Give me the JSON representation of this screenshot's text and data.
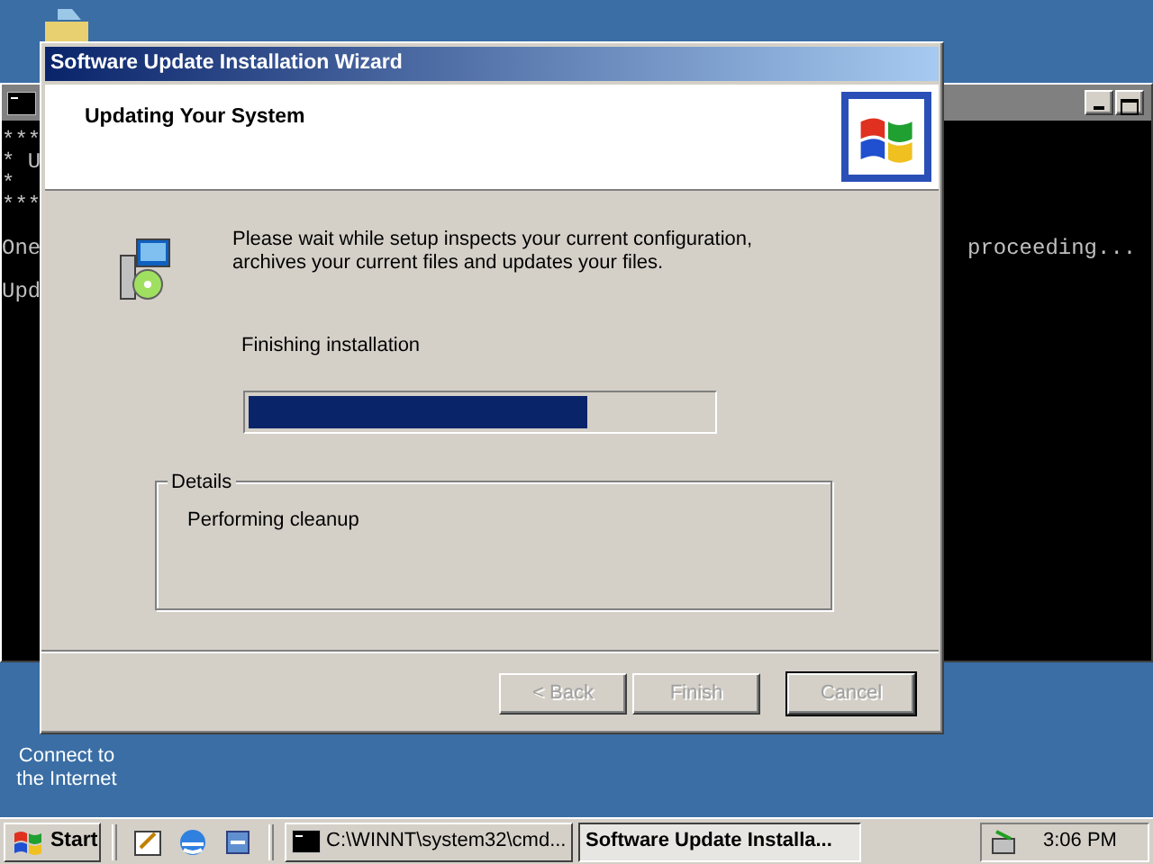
{
  "desktop_icons": [
    {
      "label": "Connect to the Internet"
    }
  ],
  "console": {
    "blocks": [
      {
        "lines": [
          "***",
          "* U",
          "*",
          "***"
        ]
      },
      {
        "lines": [
          "One"
        ],
        "tail": "proceeding..."
      },
      {
        "lines": [
          "Upd"
        ]
      }
    ]
  },
  "wizard": {
    "title": "Software Update Installation Wizard",
    "heading": "Updating Your System",
    "intro": "Please wait while setup inspects your current configuration, archives your current files and updates your files.",
    "status": "Finishing installation",
    "progress": {
      "level": 0.73
    },
    "details": {
      "legend": "Details",
      "text": "Performing cleanup"
    },
    "buttons": [
      {
        "label": "< Back",
        "disabled": true,
        "default": false
      },
      {
        "label": "Finish",
        "disabled": true,
        "default": false
      },
      {
        "label": "Cancel",
        "disabled": true,
        "default": true
      }
    ]
  },
  "taskbar": {
    "start": "Start",
    "quick_launch": [
      {
        "kind": "desktop"
      },
      {
        "kind": "browser"
      },
      {
        "kind": "channels"
      }
    ],
    "tasks": [
      {
        "label": "C:\\WINNT\\system32\\cmd...",
        "selected": false
      },
      {
        "label": "Software Update Installa...",
        "selected": true
      }
    ],
    "clock": "3:06 PM"
  }
}
